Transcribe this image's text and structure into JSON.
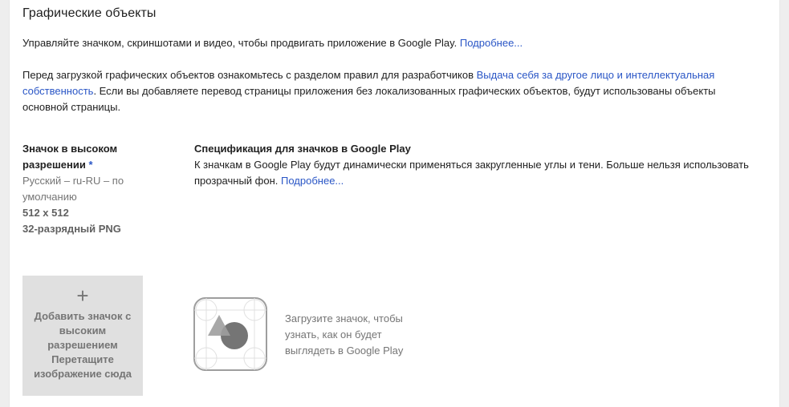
{
  "section": {
    "title": "Графические объекты"
  },
  "intro": {
    "text": "Управляйте значком, скриншотами и видео, чтобы продвигать приложение в Google Play.",
    "link": "Подробнее..."
  },
  "policy": {
    "text_before": "Перед загрузкой графических объектов ознакомьтесь с разделом правил для разработчиков",
    "link": "Выдача себя за другое лицо и интеллектуальная собственность",
    "text_after": ". Если вы добавляете перевод страницы приложения без локализованных графических объектов, будут использованы объекты основной страницы."
  },
  "hi_res_icon": {
    "title": "Значок в высоком разрешении",
    "required_mark": "*",
    "language": "Русский – ru-RU – по умолчанию",
    "size": "512 x 512",
    "format": "32-разрядный PNG"
  },
  "spec": {
    "title": "Спецификация для значков в Google Play",
    "text": "К значкам в Google Play будут динамически применяться закругленные углы и тени. Больше нельзя использовать прозрачный фон.",
    "link": "Подробнее..."
  },
  "upload": {
    "plus_icon": "plus-icon",
    "line1": "Добавить значок с высоким разрешением",
    "line2": "Перетащите изображение сюда"
  },
  "preview": {
    "icon": "icon-preview-placeholder",
    "text": "Загрузите значок, чтобы узнать, как он будет выглядеть в Google Play"
  },
  "colors": {
    "link": "#2a56c6",
    "upload_bg": "#e0e0e0",
    "muted_text": "#757575"
  }
}
